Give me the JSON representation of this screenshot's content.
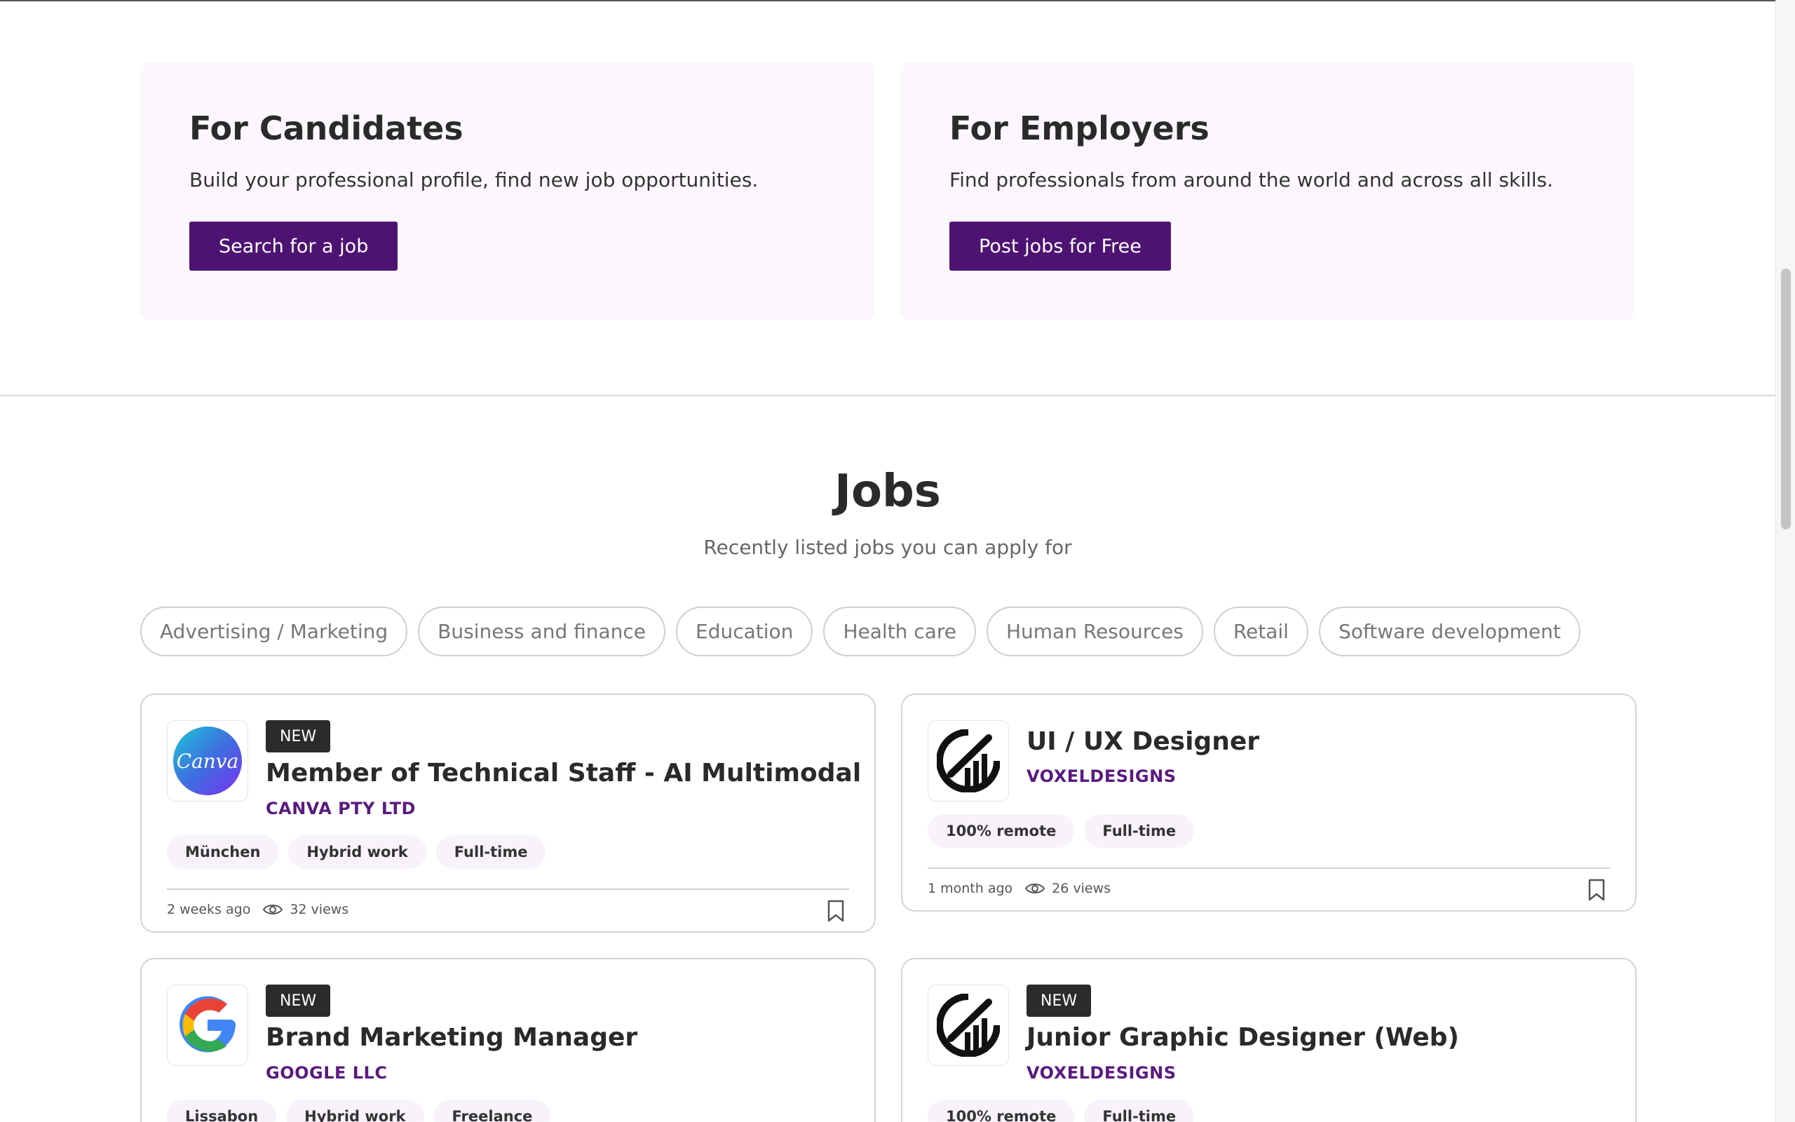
{
  "hero": {
    "candidates": {
      "title": "For Candidates",
      "text": "Build your professional profile, find new job opportunities.",
      "button": "Search for a job"
    },
    "employers": {
      "title": "For Employers",
      "text": "Find professionals from around the world and across all skills.",
      "button": "Post jobs for Free"
    }
  },
  "jobs_section": {
    "title": "Jobs",
    "subtitle": "Recently listed jobs you can apply for",
    "categories": [
      "Advertising / Marketing",
      "Business and finance",
      "Education",
      "Health care",
      "Human Resources",
      "Retail",
      "Software development"
    ]
  },
  "jobs": [
    {
      "badge": "NEW",
      "title": "Member of Technical Staff - AI Multimodal",
      "company": "CANVA PTY LTD",
      "logo": "canva-logo",
      "logo_text": "Canva",
      "tags": [
        "München",
        "Hybrid work",
        "Full-time"
      ],
      "posted": "2 weeks ago",
      "views": "32 views"
    },
    {
      "badge": "",
      "title": "UI / UX Designer",
      "company": "VOXELDESIGNS",
      "logo": "voxeldesigns-logo",
      "tags": [
        "100% remote",
        "Full-time"
      ],
      "posted": "1 month ago",
      "views": "26 views"
    },
    {
      "badge": "NEW",
      "title": "Brand Marketing Manager",
      "company": "GOOGLE LLC",
      "logo": "google-logo",
      "tags": [
        "Lissabon",
        "Hybrid work",
        "Freelance"
      ]
    },
    {
      "badge": "NEW",
      "title": "Junior Graphic Designer (Web)",
      "company": "VOXELDESIGNS",
      "logo": "voxeldesigns-logo",
      "tags": [
        "100% remote",
        "Full-time"
      ]
    }
  ],
  "colors": {
    "primary_button": "#4e1372",
    "company_text": "#5a1a80",
    "hero_card_bg": "#fcf7fe",
    "tag_bg": "#f8f3fa",
    "badge_bg": "#2b2b2b"
  },
  "icons": [
    "eye-icon",
    "bookmark-icon"
  ]
}
